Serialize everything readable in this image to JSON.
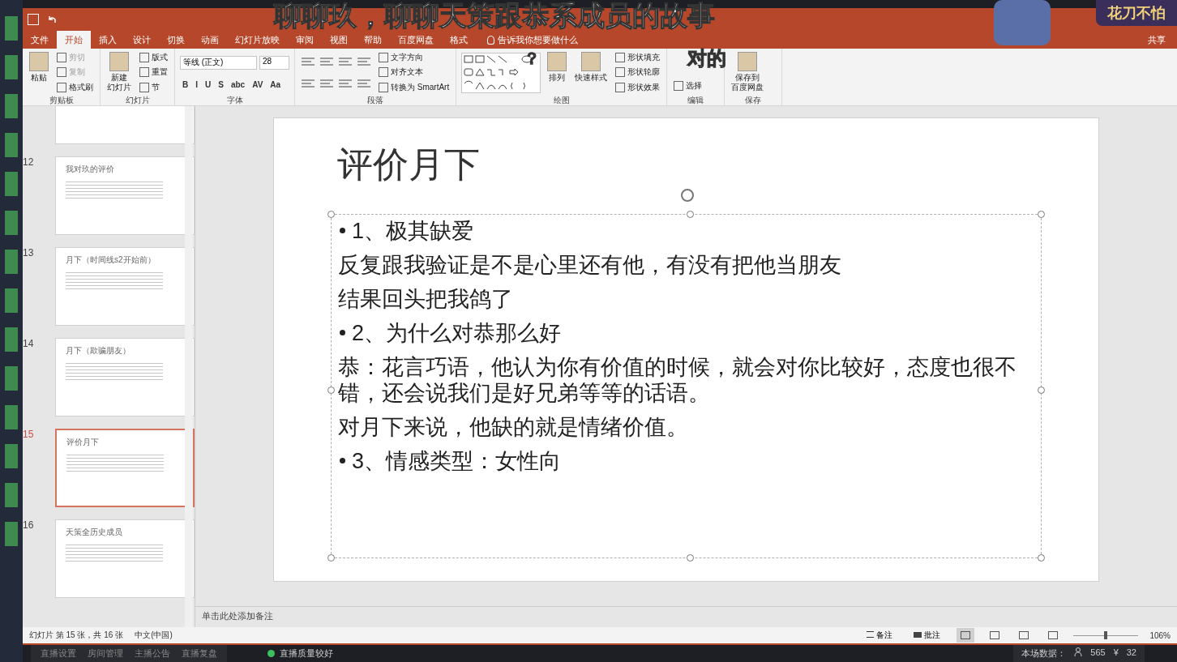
{
  "overlay": {
    "caption": "聊聊玖，聊聊天策跟恭系成员的故事",
    "caption_2": "对的",
    "mark": "？",
    "streamer_badge": "花刀不怕"
  },
  "ribbon_tabs": [
    {
      "label": "文件",
      "selected": false
    },
    {
      "label": "开始",
      "selected": true
    },
    {
      "label": "插入",
      "selected": false
    },
    {
      "label": "设计",
      "selected": false
    },
    {
      "label": "切换",
      "selected": false
    },
    {
      "label": "动画",
      "selected": false
    },
    {
      "label": "幻灯片放映",
      "selected": false
    },
    {
      "label": "审阅",
      "selected": false
    },
    {
      "label": "视图",
      "selected": false
    },
    {
      "label": "帮助",
      "selected": false
    },
    {
      "label": "百度网盘",
      "selected": false
    },
    {
      "label": "格式",
      "selected": false
    }
  ],
  "tell_me": "告诉我你想要做什么",
  "share": "共享",
  "ribbon_groups": [
    {
      "title": "剪贴板",
      "columns": [
        {
          "kind": "large",
          "lines": [
            "粘贴"
          ]
        },
        {
          "kind": "stack",
          "rows": [
            {
              "kind": "label",
              "label": "剪切",
              "disabled": true
            },
            {
              "kind": "label",
              "label": "复制",
              "disabled": true
            },
            {
              "kind": "label",
              "label": "格式刷",
              "disabled": false
            }
          ]
        }
      ]
    },
    {
      "title": "幻灯片",
      "columns": [
        {
          "kind": "large",
          "lines": [
            "新建",
            "幻灯片"
          ]
        },
        {
          "kind": "stack",
          "rows": [
            {
              "kind": "label",
              "label": "版式",
              "disabled": false
            },
            {
              "kind": "label",
              "label": "重置",
              "disabled": false
            },
            {
              "kind": "label",
              "label": "节",
              "disabled": false
            }
          ]
        }
      ]
    },
    {
      "title": "字体",
      "columns": [
        {
          "kind": "stack",
          "rows": [
            {
              "kind": "field",
              "font": "等线 (正文)",
              "size": "28"
            },
            {
              "kind": "glyphs",
              "glyphs": [
                "B",
                "I",
                "U",
                "S",
                "abc",
                "AV",
                "Aa"
              ]
            }
          ]
        }
      ]
    },
    {
      "title": "段落",
      "columns": [
        {
          "kind": "stack",
          "rows": [
            {
              "kind": "icons"
            },
            {
              "kind": "icons"
            }
          ]
        },
        {
          "kind": "stack",
          "rows": [
            {
              "kind": "label",
              "label": "文字方向",
              "disabled": false
            },
            {
              "kind": "label",
              "label": "对齐文本",
              "disabled": false
            },
            {
              "kind": "label",
              "label": "转换为 SmartArt",
              "disabled": false
            }
          ]
        }
      ]
    },
    {
      "title": "绘图",
      "columns": [
        {
          "kind": "gallery"
        },
        {
          "kind": "large",
          "lines": [
            "排列"
          ]
        },
        {
          "kind": "large",
          "lines": [
            "快速样式"
          ]
        },
        {
          "kind": "stack",
          "rows": [
            {
              "kind": "label",
              "label": "形状填充",
              "disabled": false
            },
            {
              "kind": "label",
              "label": "形状轮廓",
              "disabled": false
            },
            {
              "kind": "label",
              "label": "形状效果",
              "disabled": false
            }
          ]
        }
      ]
    },
    {
      "title": "编辑",
      "columns": [
        {
          "kind": "stack",
          "rows": [
            {
              "kind": "label",
              "label": "选择",
              "disabled": false
            }
          ]
        }
      ]
    },
    {
      "title": "保存",
      "columns": [
        {
          "kind": "large",
          "lines": [
            "保存到",
            "百度网盘"
          ]
        }
      ]
    }
  ],
  "thumbnails": [
    {
      "number": "12",
      "title": "我对玖的评价",
      "selected": false
    },
    {
      "number": "13",
      "title": "月下（时间线s2开始前）",
      "selected": false
    },
    {
      "number": "14",
      "title": "月下（欺骗朋友）",
      "selected": false
    },
    {
      "number": "15",
      "title": "评价月下",
      "selected": true
    },
    {
      "number": "16",
      "title": "天策全历史成员",
      "selected": false
    }
  ],
  "slide": {
    "title": "评价月下",
    "body": [
      {
        "kind": "bullet",
        "text": "1、极其缺爱"
      },
      {
        "kind": "plain",
        "text": "反复跟我验证是不是心里还有他，有没有把他当朋友"
      },
      {
        "kind": "plain",
        "text": "结果回头把我鸽了"
      },
      {
        "kind": "bullet",
        "text": "2、为什么对恭那么好"
      },
      {
        "kind": "plain",
        "text": "恭：花言巧语，他认为你有价值的时候，就会对你比较好，态度也很不错，还会说我们是好兄弟等等的话语。"
      },
      {
        "kind": "plain",
        "text": "对月下来说，他缺的就是情绪价值。"
      },
      {
        "kind": "bullet",
        "text": "3、情感类型：女性向"
      }
    ]
  },
  "notes": {
    "placeholder": "单击此处添加备注"
  },
  "status_bar": {
    "slide_info": "幻灯片 第 15 张，共 16 张",
    "language": "中文(中国)",
    "notes": "备注",
    "comments": "批注",
    "views": [
      {
        "selected": true
      },
      {
        "selected": false
      },
      {
        "selected": false
      },
      {
        "selected": false
      }
    ],
    "zoom": {
      "level": 0.5
    },
    "zoom_text": "106%"
  },
  "stream_bar": {
    "menu": [
      "直播设置",
      "房间管理",
      "主播公告",
      "直播复盘"
    ],
    "quality": "直播质量较好",
    "stats_label": "本场数据：",
    "viewers": "565",
    "coin_symbol": "¥",
    "coins": "32"
  }
}
